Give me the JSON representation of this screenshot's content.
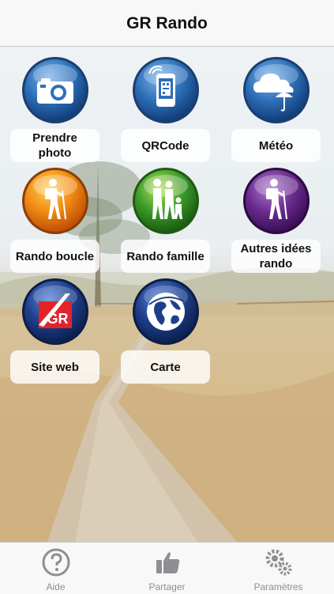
{
  "nav": {
    "title": "GR Rando"
  },
  "grid": [
    {
      "name": "prendre-photo",
      "label": "Prendre\nphoto",
      "icon": "camera-icon",
      "color": "#2d6fb8"
    },
    {
      "name": "qrcode",
      "label": "QRCode",
      "icon": "qrcode-phone-icon",
      "color": "#2d6fb8"
    },
    {
      "name": "meteo",
      "label": "Météo",
      "icon": "weather-cloud-umbrella-icon",
      "color": "#2d6fb8"
    },
    {
      "name": "rando-boucle",
      "label": "Rando boucle",
      "icon": "hiker-icon",
      "color": "#f08a12"
    },
    {
      "name": "rando-famille",
      "label": "Rando famille",
      "icon": "family-hikers-icon",
      "color": "#3c9a2a"
    },
    {
      "name": "autres-idees-rando",
      "label": "Autres idées\nrando",
      "icon": "hiker-icon",
      "color": "#6a2c8e"
    },
    {
      "name": "site-web",
      "label": "Site web",
      "icon": "gr-logo-icon",
      "color": "#1f3f8c"
    },
    {
      "name": "carte",
      "label": "Carte",
      "icon": "globe-icon",
      "color": "#1f3f8c"
    }
  ],
  "tabs": [
    {
      "name": "aide",
      "label": "Aide",
      "icon": "help-icon"
    },
    {
      "name": "partager",
      "label": "Partager",
      "icon": "thumbs-up-icon"
    },
    {
      "name": "parametres",
      "label": "Paramètres",
      "icon": "gear-icon"
    }
  ]
}
